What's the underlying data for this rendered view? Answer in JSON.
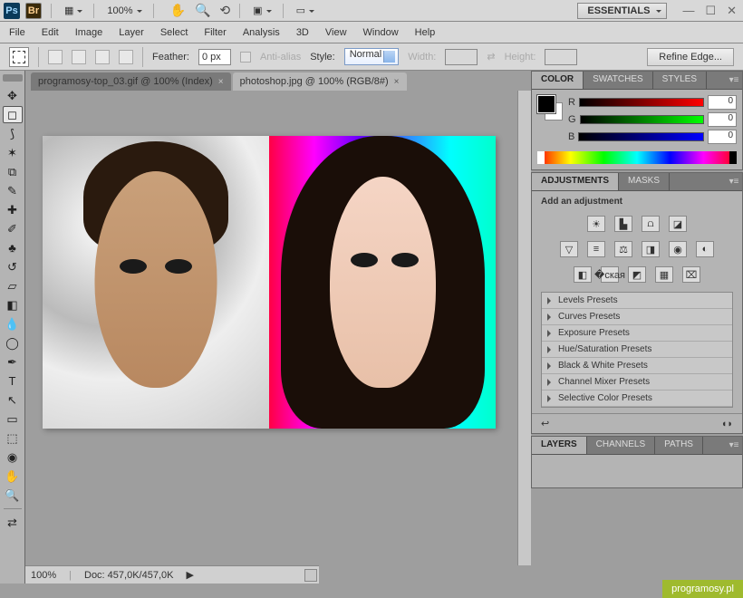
{
  "topbar": {
    "zoom": "100%",
    "workspace": "ESSENTIALS"
  },
  "menu": [
    "File",
    "Edit",
    "Image",
    "Layer",
    "Select",
    "Filter",
    "Analysis",
    "3D",
    "View",
    "Window",
    "Help"
  ],
  "options": {
    "feather_label": "Feather:",
    "feather_value": "0 px",
    "antialias": "Anti-alias",
    "style_label": "Style:",
    "style_value": "Normal",
    "width_label": "Width:",
    "height_label": "Height:",
    "refine": "Refine Edge..."
  },
  "docTabs": [
    {
      "label": "programosy-top_03.gif @ 100% (Index)"
    },
    {
      "label": "photoshop.jpg @ 100% (RGB/8#)"
    }
  ],
  "status": {
    "zoom": "100%",
    "doc": "Doc: 457,0K/457,0K"
  },
  "panels": {
    "color": {
      "tabs": [
        "COLOR",
        "SWATCHES",
        "STYLES"
      ],
      "channels": [
        {
          "l": "R",
          "v": "0"
        },
        {
          "l": "G",
          "v": "0"
        },
        {
          "l": "B",
          "v": "0"
        }
      ]
    },
    "adjustments": {
      "tabs": [
        "ADJUSTMENTS",
        "MASKS"
      ],
      "title": "Add an adjustment",
      "presets": [
        "Levels Presets",
        "Curves Presets",
        "Exposure Presets",
        "Hue/Saturation Presets",
        "Black & White Presets",
        "Channel Mixer Presets",
        "Selective Color Presets"
      ]
    },
    "layers": {
      "tabs": [
        "LAYERS",
        "CHANNELS",
        "PATHS"
      ]
    }
  },
  "watermark": "programosy.pl"
}
